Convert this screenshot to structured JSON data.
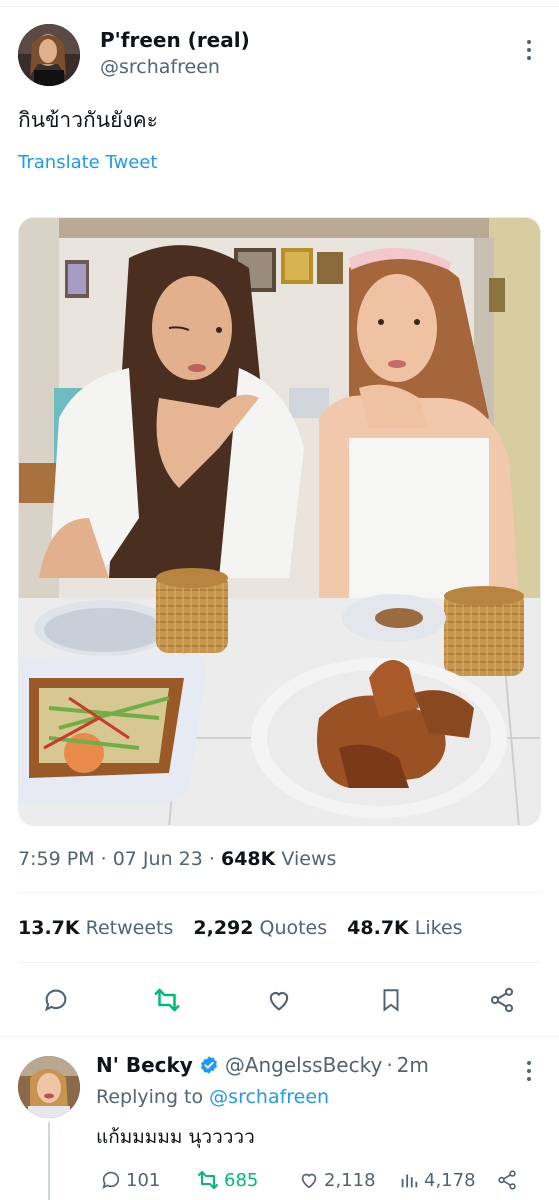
{
  "tweet": {
    "display_name": "P'freen (real)",
    "handle": "@srchafreen",
    "text": "กินข้าวกันยังคะ",
    "translate_label": "Translate Tweet",
    "time": "7:59 PM",
    "date": "07 Jun 23",
    "views_count": "648K",
    "views_label": "Views",
    "retweets_count": "13.7K",
    "retweets_label": "Retweets",
    "quotes_count": "2,292",
    "quotes_label": "Quotes",
    "likes_count": "48.7K",
    "likes_label": "Likes"
  },
  "icons": {
    "more": "more-icon",
    "reply": "reply-icon",
    "retweet": "retweet-icon",
    "like": "heart-icon",
    "bookmark": "bookmark-icon",
    "share": "share-icon",
    "verified": "verified-badge-icon",
    "views": "views-chart-icon"
  },
  "reply": {
    "display_name": "N' Becky",
    "handle": "@AngelssBecky",
    "separator": "·",
    "time": "2m",
    "replying_prefix": "Replying to",
    "replying_to": "@srchafreen",
    "text": "แก้มมมมม นุววววว",
    "reply_count": "101",
    "retweet_count": "685",
    "like_count": "2,118",
    "view_count": "4,178"
  },
  "colors": {
    "accent": "#1d9bf0",
    "retweet_green": "#00ba7c",
    "secondary_text": "#536471",
    "primary_text": "#0f1419"
  }
}
